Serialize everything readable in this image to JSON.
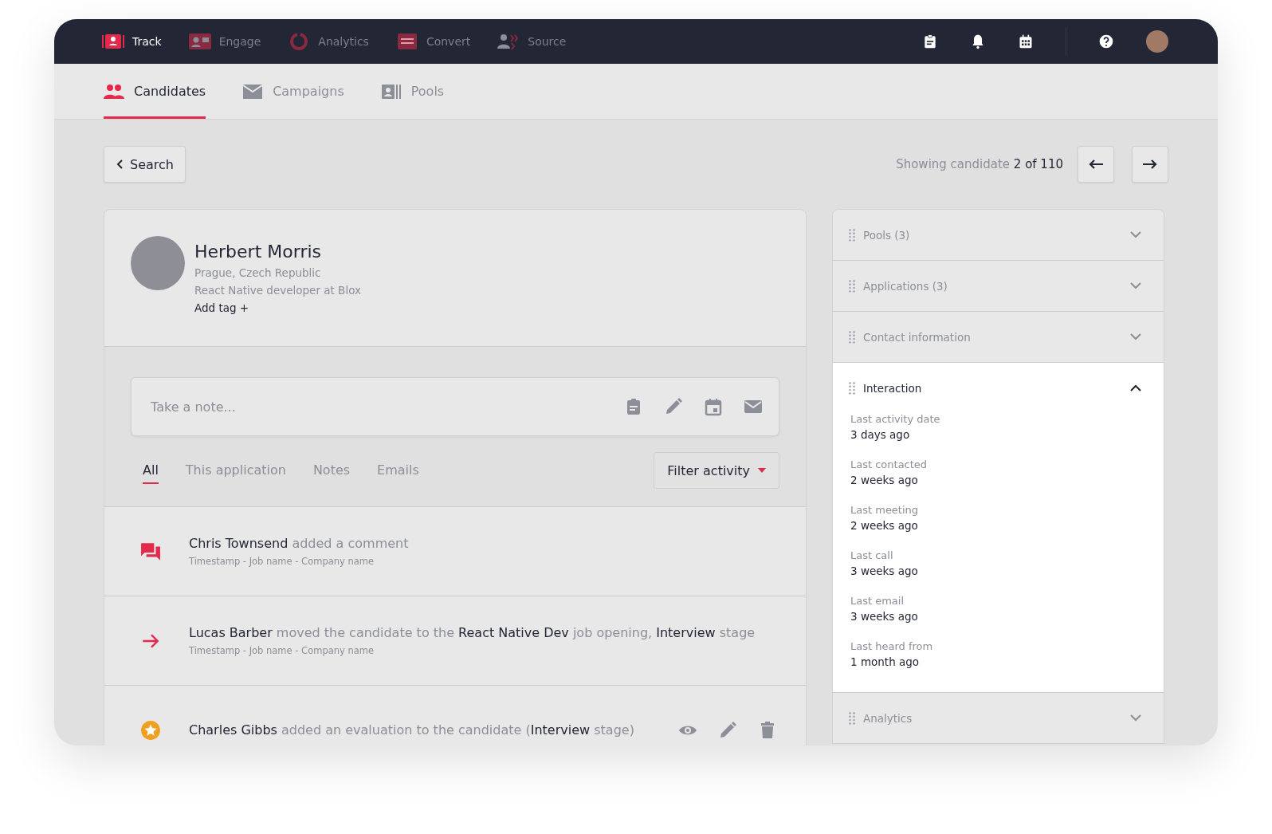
{
  "top_nav": {
    "items": [
      {
        "label": "Track",
        "kind": "track",
        "selected": true
      },
      {
        "label": "Engage",
        "kind": "engage",
        "selected": false
      },
      {
        "label": "Analytics",
        "kind": "analytics",
        "selected": false
      },
      {
        "label": "Convert",
        "kind": "convert",
        "selected": false
      },
      {
        "label": "Source",
        "kind": "source",
        "selected": false
      }
    ]
  },
  "sub_nav": {
    "tabs": [
      {
        "label": "Candidates",
        "kind": "people",
        "selected": true
      },
      {
        "label": "Campaigns",
        "kind": "mail",
        "selected": false
      },
      {
        "label": "Pools",
        "kind": "pools",
        "selected": false
      }
    ]
  },
  "toolbar": {
    "back_button": "Search",
    "counter_prefix": "Showing candidate",
    "counter_value": "2 of 110"
  },
  "candidate": {
    "name": "Herbert Morris",
    "location": "Prague, Czech Republic",
    "headline": "React Native developer at Blox",
    "add_tag": "Add tag +"
  },
  "note": {
    "placeholder": "Take a note..."
  },
  "activity_tabs": [
    {
      "label": "All",
      "selected": true
    },
    {
      "label": "This application",
      "selected": false
    },
    {
      "label": "Notes",
      "selected": false
    },
    {
      "label": "Emails",
      "selected": false
    }
  ],
  "filter_button": "Filter activity",
  "activities": [
    {
      "kind": "comment",
      "text": "**Chris Townsend** added a comment",
      "meta": "Timestamp -  Job name - Company name"
    },
    {
      "kind": "move",
      "text": "**Lucas Barber** moved the candidate to the **React Native Dev** job opening, **Interview** stage",
      "meta": "Timestamp -  Job name - Company name"
    },
    {
      "kind": "evaluation",
      "text": "**Charles Gibbs** added an evaluation to the candidate (**Interview** stage)"
    }
  ],
  "side_sections": [
    {
      "title": "Pools (3)",
      "expanded": false
    },
    {
      "title": "Applications (3)",
      "expanded": false
    },
    {
      "title": "Contact information",
      "expanded": false
    },
    {
      "title": "Interaction",
      "expanded": true,
      "fields": [
        {
          "label": "Last activity date",
          "value": "3 days ago"
        },
        {
          "label": "Last contacted",
          "value": "2 weeks ago"
        },
        {
          "label": "Last meeting",
          "value": "2 weeks ago"
        },
        {
          "label": "Last call",
          "value": "3 weeks ago"
        },
        {
          "label": "Last email",
          "value": "3 weeks ago"
        },
        {
          "label": "Last heard from",
          "value": "1 month ago"
        }
      ]
    },
    {
      "title": "Analytics",
      "expanded": false
    }
  ]
}
